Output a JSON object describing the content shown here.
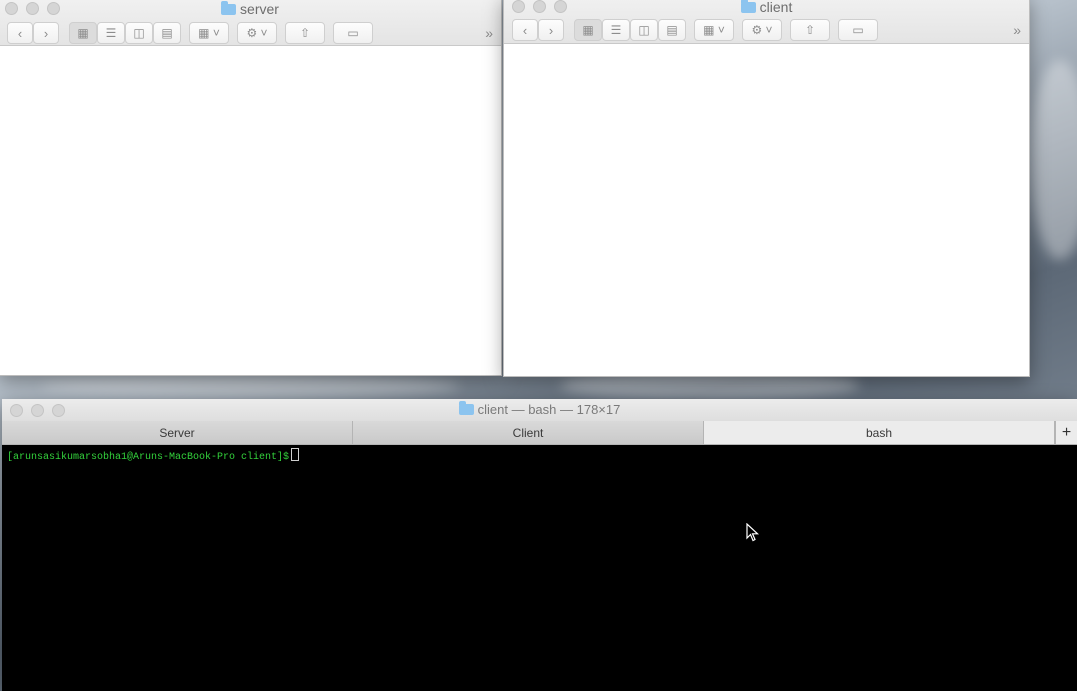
{
  "server_window": {
    "title": "server",
    "more_label": "»"
  },
  "client_window": {
    "title": "client",
    "more_label": "»"
  },
  "terminal": {
    "title": "client — bash — 178×17",
    "tabs": [
      {
        "label": "Server"
      },
      {
        "label": "Client"
      },
      {
        "label": "bash"
      }
    ],
    "add_tab_label": "+",
    "prompt": "[arunsasikumarsobha1@Aruns-MacBook-Pro client]$",
    "prompt_color": "#33d23c"
  },
  "icons": {
    "back": "chevron-left-icon",
    "forward": "chevron-right-icon",
    "icon_view": "grid-icon",
    "list_view": "list-icon",
    "column_view": "columns-icon",
    "cover_flow": "coverflow-icon",
    "arrange": "arrange-icon",
    "action": "gear-icon",
    "share": "share-icon",
    "tag": "tag-icon"
  }
}
